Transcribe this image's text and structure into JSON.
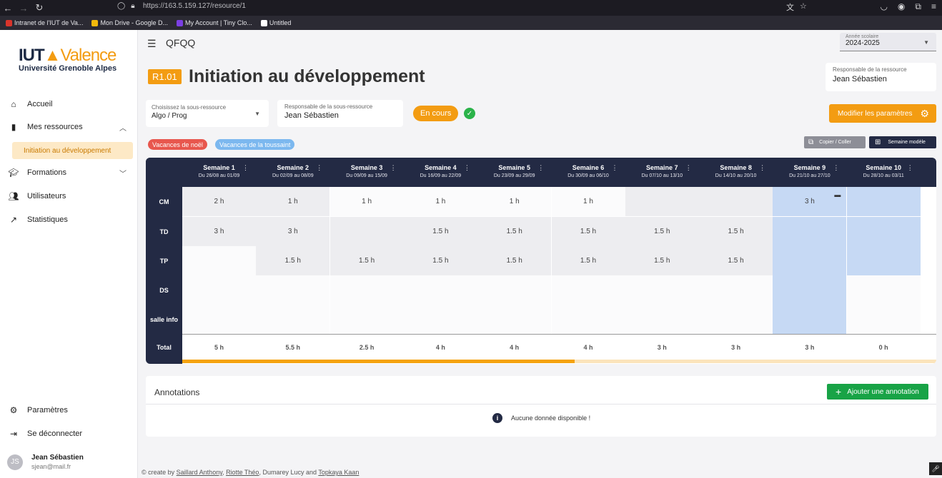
{
  "browser": {
    "url": "https://163.5.159.127/resource/1",
    "bookmarks": [
      "Intranet de l'IUT de Va...",
      "Mon Drive - Google D...",
      "My Account | Tiny Clo...",
      "Untitled"
    ]
  },
  "sidebar": {
    "logo_brand": "IUT",
    "logo_city": "Valence",
    "logo_sub": "Université Grenoble Alpes",
    "items": [
      {
        "label": "Accueil",
        "icon": "home-icon"
      },
      {
        "label": "Mes ressources",
        "icon": "book-icon"
      },
      {
        "label": "Formations",
        "icon": "school-icon"
      },
      {
        "label": "Utilisateurs",
        "icon": "users-icon"
      },
      {
        "label": "Statistiques",
        "icon": "trend-icon"
      }
    ],
    "active_sub": "Initiation au développement",
    "settings_label": "Paramètres",
    "logout_label": "Se déconnecter",
    "user": {
      "initials": "JS",
      "name": "Jean Sébastien",
      "email": "sjean@mail.fr"
    }
  },
  "topbar": {
    "app_name": "QFQQ",
    "year_label": "Année scolaire",
    "year_value": "2024-2025"
  },
  "resource": {
    "code": "R1.01",
    "title": "Initiation au développement",
    "resp_label": "Responsable de la ressource",
    "resp_value": "Jean Sébastien",
    "subres_label": "Choisissez la sous-ressource",
    "subres_value": "Algo / Prog",
    "subres_resp_label": "Responsable de la sous-ressource",
    "subres_resp_value": "Jean Sébastien",
    "status": "En cours",
    "params_button": "Modifier les paramètres"
  },
  "tags": [
    "Vacances de noël",
    "Vacances de la toussaint"
  ],
  "actions": {
    "copy": "Copier / Coller",
    "model": "Semaine modèle"
  },
  "table": {
    "weeks": [
      {
        "title": "Semaine 1",
        "dates": "Du 26/08 au 01/09"
      },
      {
        "title": "Semaine 2",
        "dates": "Du 02/09 au 08/09"
      },
      {
        "title": "Semaine 3",
        "dates": "Du 09/09 au 15/09"
      },
      {
        "title": "Semaine 4",
        "dates": "Du 16/09 au 22/09"
      },
      {
        "title": "Semaine 5",
        "dates": "Du 23/09 au 29/09"
      },
      {
        "title": "Semaine 6",
        "dates": "Du 30/09 au 06/10"
      },
      {
        "title": "Semaine 7",
        "dates": "Du 07/10 au 13/10"
      },
      {
        "title": "Semaine 8",
        "dates": "Du 14/10 au 20/10"
      },
      {
        "title": "Semaine 9",
        "dates": "Du 21/10 au 27/10"
      },
      {
        "title": "Semaine 10",
        "dates": "Du 28/10 au 03/11"
      }
    ],
    "rows": [
      {
        "label": "CM",
        "values": [
          "2 h",
          "1 h",
          "1 h",
          "1 h",
          "1 h",
          "1 h",
          "",
          "",
          "3 h",
          ""
        ]
      },
      {
        "label": "TD",
        "values": [
          "3 h",
          "3 h",
          "",
          "1.5 h",
          "1.5 h",
          "1.5 h",
          "1.5 h",
          "1.5 h",
          "",
          ""
        ]
      },
      {
        "label": "TP",
        "values": [
          "",
          "1.5 h",
          "1.5 h",
          "1.5 h",
          "1.5 h",
          "1.5 h",
          "1.5 h",
          "1.5 h",
          "",
          ""
        ]
      },
      {
        "label": "DS",
        "values": [
          "",
          "",
          "",
          "",
          "",
          "",
          "",
          "",
          "",
          ""
        ]
      },
      {
        "label": "salle info",
        "values": [
          "",
          "",
          "",
          "",
          "",
          "",
          "",
          "",
          "",
          ""
        ]
      }
    ],
    "total_label": "Total",
    "totals": [
      "5 h",
      "5.5 h",
      "2.5 h",
      "4 h",
      "4 h",
      "4 h",
      "3 h",
      "3 h",
      "3 h",
      "0 h"
    ],
    "progress": 0.52
  },
  "annotations": {
    "title": "Annotations",
    "add_button": "Ajouter une annotation",
    "empty": "Aucune donnée disponible !"
  },
  "footer": {
    "prefix": "© create by ",
    "authors": [
      "Saillard Anthony",
      "Riotte Théo",
      "Dumarey Lucy",
      "Topkaya Kaan"
    ]
  }
}
